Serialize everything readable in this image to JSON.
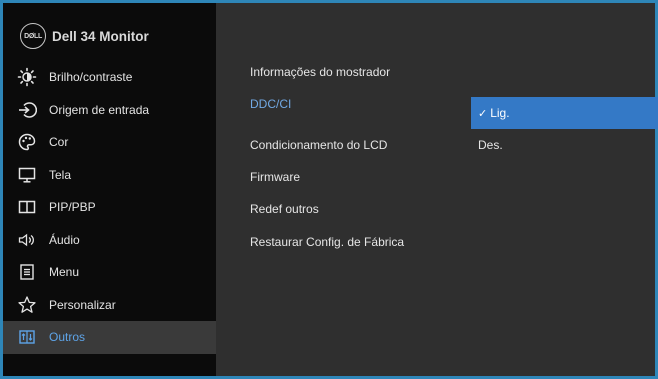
{
  "brand": {
    "logo_text": "DØLL",
    "title": "Dell  34 Monitor"
  },
  "menu": {
    "items": [
      {
        "label": "Brilho/contraste",
        "icon": "brightness-icon"
      },
      {
        "label": "Origem de entrada",
        "icon": "input-source-icon"
      },
      {
        "label": "Cor",
        "icon": "color-palette-icon"
      },
      {
        "label": "Tela",
        "icon": "display-icon"
      },
      {
        "label": "PIP/PBP",
        "icon": "pip-pbp-icon"
      },
      {
        "label": "Áudio",
        "icon": "speaker-icon"
      },
      {
        "label": "Menu",
        "icon": "menu-icon"
      },
      {
        "label": "Personalizar",
        "icon": "star-icon"
      },
      {
        "label": "Outros",
        "icon": "others-icon"
      }
    ],
    "active_index": 8
  },
  "options": [
    {
      "label": "Informações do mostrador"
    },
    {
      "label": "DDC/CI",
      "selected": true
    },
    {
      "label": "Condicionamento do LCD"
    },
    {
      "label": "Firmware"
    },
    {
      "label": "Redef outros"
    },
    {
      "label": "Restaurar Config. de Fábrica"
    }
  ],
  "submenu": {
    "items": [
      {
        "label": "Lig.",
        "checked": true,
        "mark": "✓"
      },
      {
        "label": "Des.",
        "checked": false
      }
    ]
  },
  "colors": {
    "frame_border": "#2e86b8",
    "sidebar_bg": "#0b0b0b",
    "panel_bg": "#2f2f2f",
    "active_text": "#5ea4e8",
    "selected_bg": "#3479c6"
  }
}
